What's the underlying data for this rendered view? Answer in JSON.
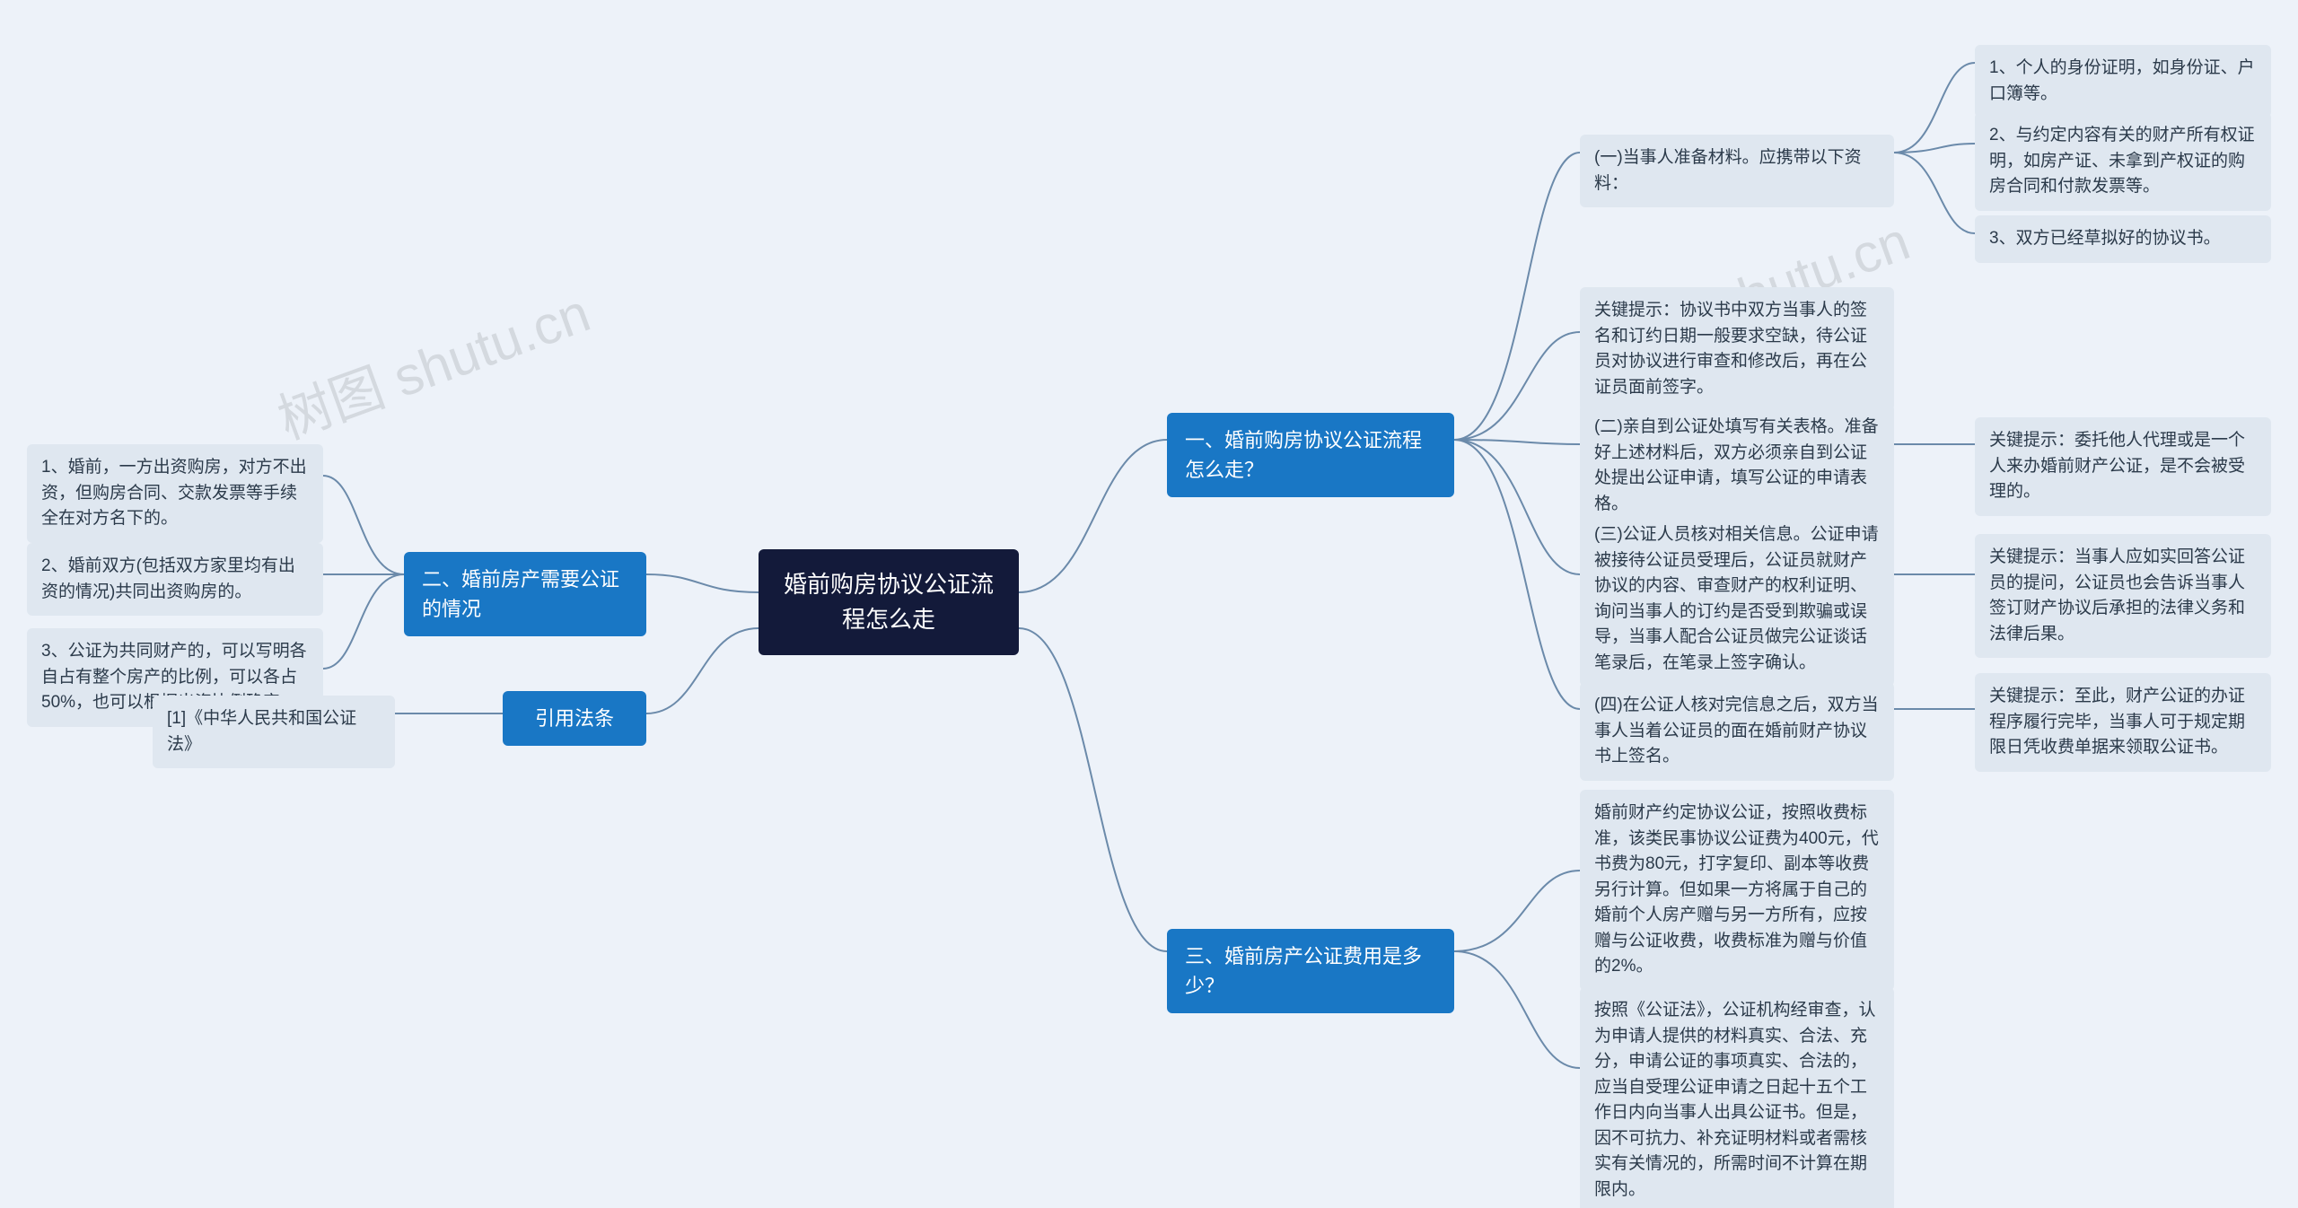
{
  "root": {
    "text": "婚前购房协议公证流程怎么走"
  },
  "right": {
    "s1": {
      "label": "一、婚前购房协议公证流程怎么走？",
      "c1": {
        "label": "(一)当事人准备材料。应携带以下资料：",
        "l1": "1、个人的身份证明，如身份证、户口簿等。",
        "l2": "2、与约定内容有关的财产所有权证明，如房产证、未拿到产权证的购房合同和付款发票等。",
        "l3": "3、双方已经草拟好的协议书。"
      },
      "tip1": "关键提示：协议书中双方当事人的签名和订约日期一般要求空缺，待公证员对协议进行审查和修改后，再在公证员面前签字。",
      "c2": {
        "label": "(二)亲自到公证处填写有关表格。准备好上述材料后，双方必须亲自到公证处提出公证申请，填写公证的申请表格。",
        "tip": "关键提示：委托他人代理或是一个人来办婚前财产公证，是不会被受理的。"
      },
      "c3": {
        "label": "(三)公证人员核对相关信息。公证申请被接待公证员受理后，公证员就财产协议的内容、审查财产的权利证明、询问当事人的订约是否受到欺骗或误导，当事人配合公证员做完公证谈话笔录后，在笔录上签字确认。",
        "tip": "关键提示：当事人应如实回答公证员的提问，公证员也会告诉当事人签订财产协议后承担的法律义务和法律后果。"
      },
      "c4": {
        "label": "(四)在公证人核对完信息之后，双方当事人当着公证员的面在婚前财产协议书上签名。",
        "tip": "关键提示：至此，财产公证的办证程序履行完毕，当事人可于规定期限日凭收费单据来领取公证书。"
      }
    },
    "s3": {
      "label": "三、婚前房产公证费用是多少？",
      "l1": "婚前财产约定协议公证，按照收费标准，该类民事协议公证费为400元，代书费为80元，打字复印、副本等收费另行计算。但如果一方将属于自己的婚前个人房产赠与另一方所有，应按赠与公证收费，收费标准为赠与价值的2%。",
      "l2": "按照《公证法》，公证机构经审查，认为申请人提供的材料真实、合法、充分，申请公证的事项真实、合法的，应当自受理公证申请之日起十五个工作日内向当事人出具公证书。但是，因不可抗力、补充证明材料或者需核实有关情况的，所需时间不计算在期限内。"
    }
  },
  "left": {
    "s2": {
      "label": "二、婚前房产需要公证的情况",
      "l1": "1、婚前，一方出资购房，对方不出资，但购房合同、交款发票等手续全在对方名下的。",
      "l2": "2、婚前双方(包括双方家里均有出资的情况)共同出资购房的。",
      "l3": "3、公证为共同财产的，可以写明各自占有整个房产的比例，可以各占50%，也可以根据出资比例确定。"
    },
    "ref": {
      "label": "引用法条",
      "l1": "[1]《中华人民共和国公证法》"
    }
  },
  "watermark": "树图 shutu.cn"
}
